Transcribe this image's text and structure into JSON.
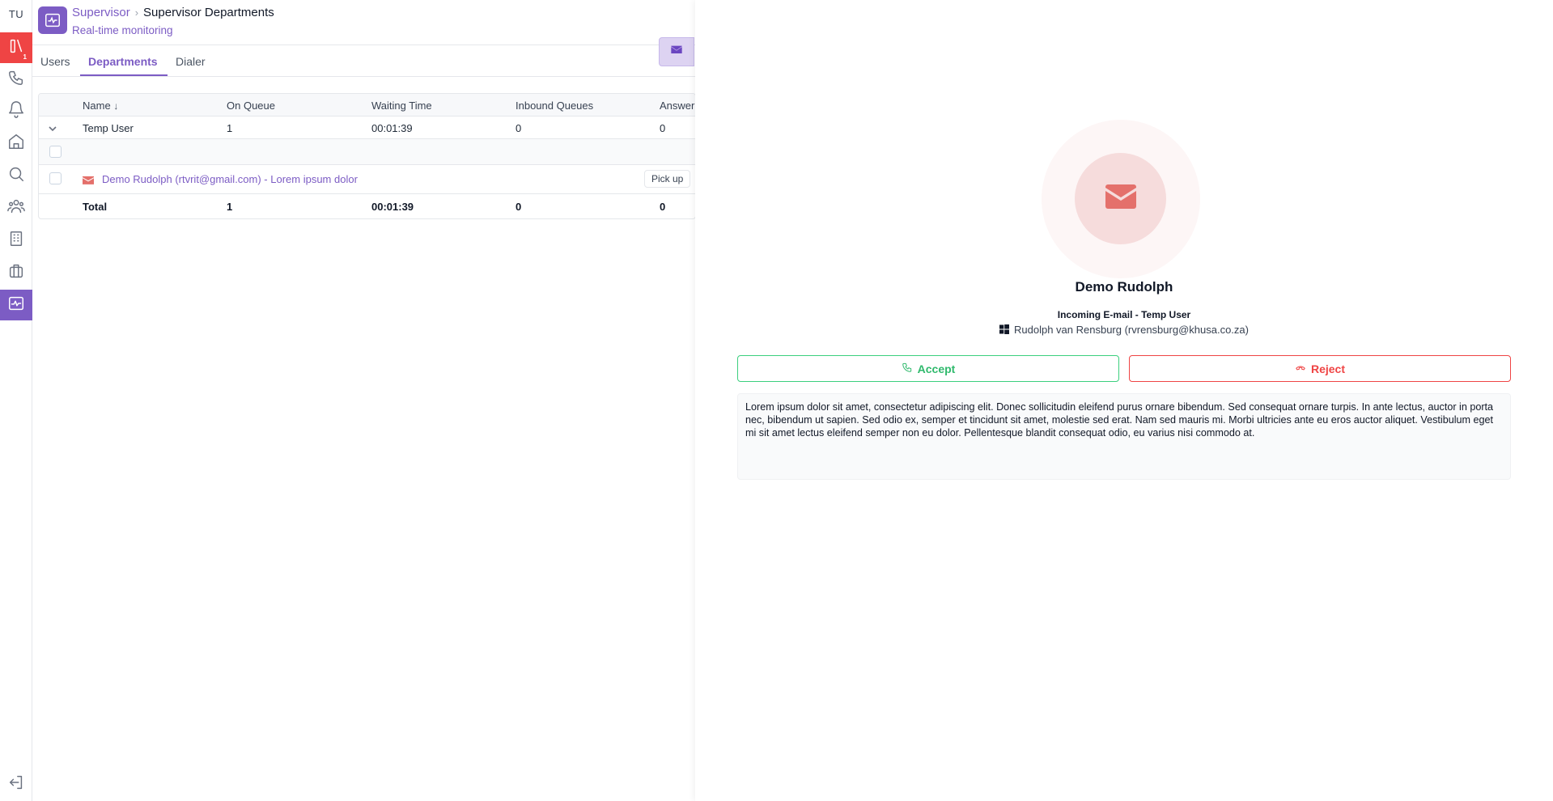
{
  "user": {
    "initials": "TU"
  },
  "rail": {
    "items": [
      {
        "name": "queue-icon",
        "badge": "1"
      },
      {
        "name": "phone-icon"
      },
      {
        "name": "bell-icon"
      },
      {
        "name": "home-icon"
      },
      {
        "name": "search-icon"
      },
      {
        "name": "users-icon"
      },
      {
        "name": "building-icon"
      },
      {
        "name": "briefcase-icon"
      },
      {
        "name": "activity-icon"
      },
      {
        "name": "logout-icon"
      }
    ]
  },
  "header": {
    "breadcrumb_root": "Supervisor",
    "breadcrumb_current": "Supervisor Departments",
    "subtitle": "Real-time monitoring"
  },
  "tabs": [
    {
      "label": "Users"
    },
    {
      "label": "Departments"
    },
    {
      "label": "Dialer"
    }
  ],
  "table": {
    "columns": [
      "Name",
      "On Queue",
      "Waiting Time",
      "Inbound Queues",
      "Answer"
    ],
    "sort_indicator": "↓",
    "group_row": {
      "name": "Temp User",
      "on_queue": "1",
      "waiting_time": "00:01:39",
      "inbound_queues": "0",
      "answer": "0"
    },
    "email_row": {
      "text": "Demo Rudolph (rtvrit@gmail.com) - Lorem ipsum dolor",
      "action": "Pick up"
    },
    "total_row": {
      "name": "Total",
      "on_queue": "1",
      "waiting_time": "00:01:39",
      "inbound_queues": "0",
      "answer": "0"
    }
  },
  "panel": {
    "caller_name": "Demo Rudolph",
    "incoming_label": "Incoming E-mail - Temp User",
    "owner": "Rudolph van Rensburg (rvrensburg@khusa.co.za)",
    "accept_label": "Accept",
    "reject_label": "Reject",
    "message": "Lorem ipsum dolor sit amet, consectetur adipiscing elit. Donec sollicitudin eleifend purus ornare bibendum. Sed consequat ornare turpis. In ante lectus, auctor in porta nec, bibendum ut sapien. Sed odio ex, semper et tincidunt sit amet, molestie sed erat. Nam sed mauris mi. Morbi ultricies ante eu eros auctor aliquet. Vestibulum eget mi sit amet lectus eleifend semper non eu dolor. Pellentesque blandit consequat odio, eu varius nisi commodo at."
  },
  "colors": {
    "accent": "#7c5cc4",
    "alert": "#ef4444",
    "accept": "#2fb96c"
  }
}
